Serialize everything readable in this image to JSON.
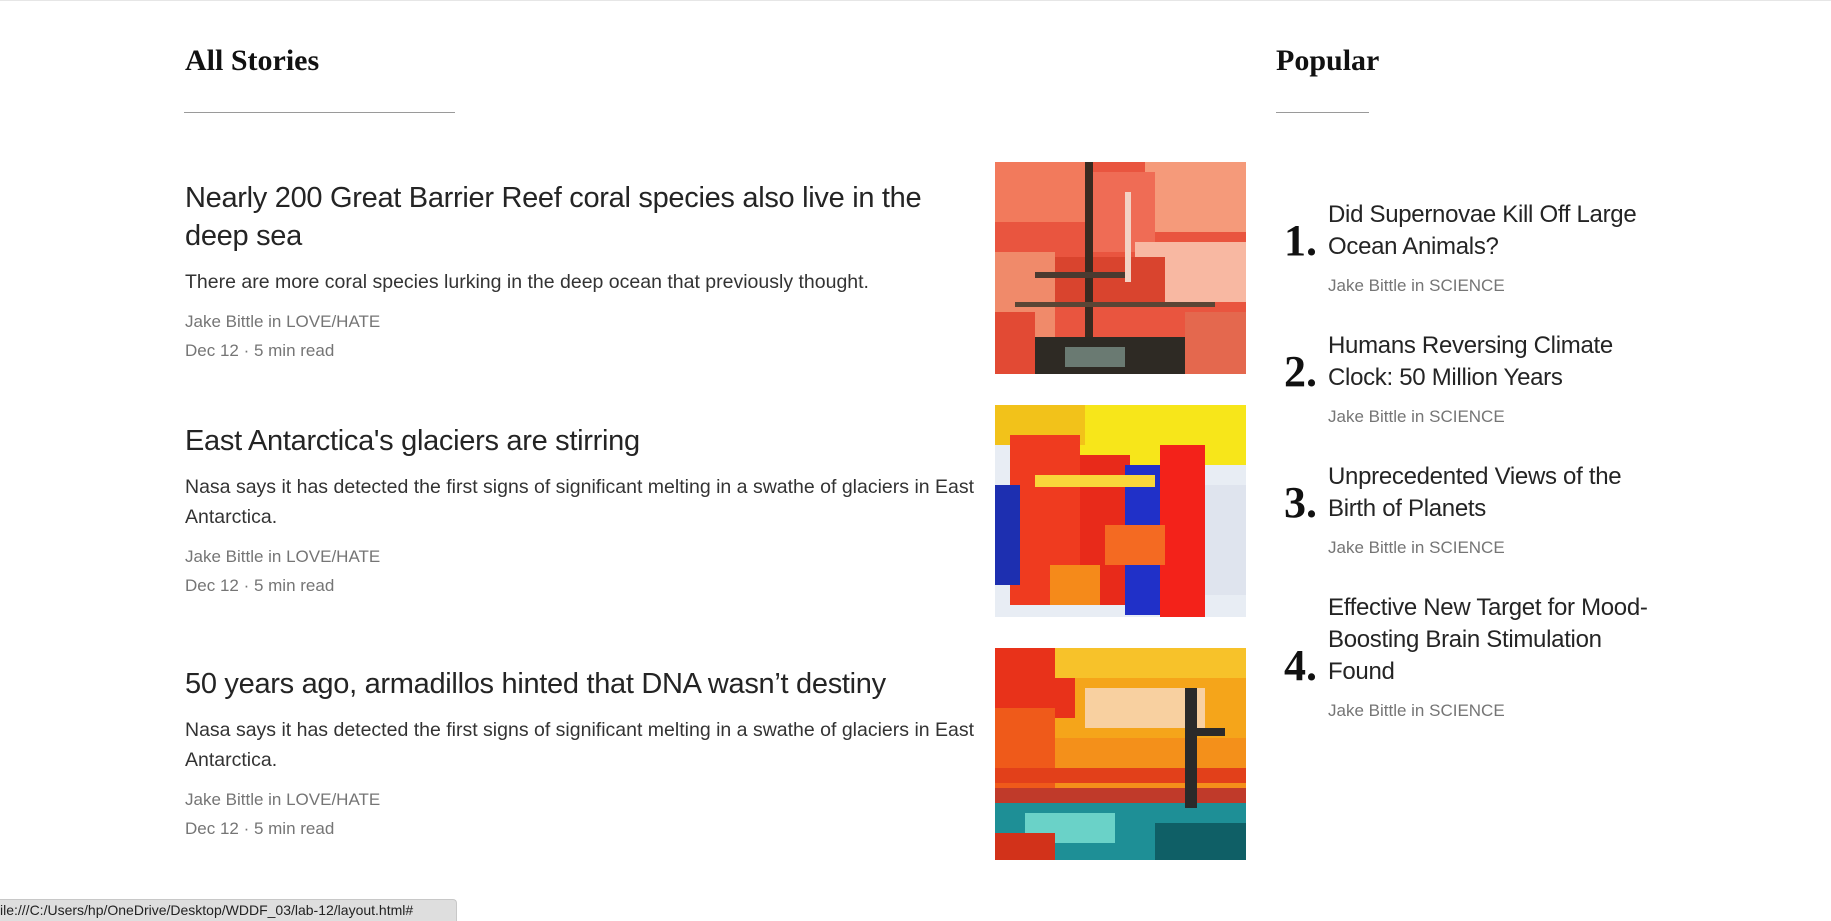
{
  "all_stories": {
    "heading": "All Stories",
    "stories": [
      {
        "title": "Nearly 200 Great Barrier Reef coral species also live in the deep sea",
        "description": "There are more coral species lurking in the deep ocean that previously thought.",
        "author_line": "Jake Bittle in LOVE/HATE",
        "date_line": "Dec 12 · 5 min read",
        "image": "abstract-painting-red-coral"
      },
      {
        "title": "East Antarctica's glaciers are stirring",
        "description": "Nasa says it has detected the first signs of significant melting in a swathe of glaciers in East Antarctica.",
        "author_line": "Jake Bittle in LOVE/HATE",
        "date_line": "Dec 12 · 5 min read",
        "image": "abstract-painting-red-blue-yellow"
      },
      {
        "title": "50 years ago, armadillos hinted that DNA wasn’t destiny",
        "description": "Nasa says it has detected the first signs of significant melting in a swathe of glaciers in East Antarctica.",
        "author_line": "Jake Bittle in LOVE/HATE",
        "date_line": "Dec 12 · 5 min read",
        "image": "abstract-painting-orange-teal"
      }
    ]
  },
  "popular": {
    "heading": "Popular",
    "items": [
      {
        "rank": "1.",
        "title": "Did Supernovae Kill Off Large Ocean Animals?",
        "meta": "Jake Bittle in SCIENCE"
      },
      {
        "rank": "2.",
        "title": "Humans Reversing Climate Clock: 50 Million Years",
        "meta": "Jake Bittle in SCIENCE"
      },
      {
        "rank": "3.",
        "title": "Unprecedented Views of the Birth of Planets",
        "meta": "Jake Bittle in SCIENCE"
      },
      {
        "rank": "4.",
        "title": "Effective New Target for Mood-Boosting Brain Stimulation Found",
        "meta": "Jake Bittle in SCIENCE"
      }
    ]
  },
  "status_bar": {
    "url": "ile:///C:/Users/hp/OneDrive/Desktop/WDDF_03/lab-12/layout.html#"
  },
  "colors": {
    "text_primary": "#242424",
    "text_meta": "#757575",
    "rule": "#9a9a9a"
  }
}
